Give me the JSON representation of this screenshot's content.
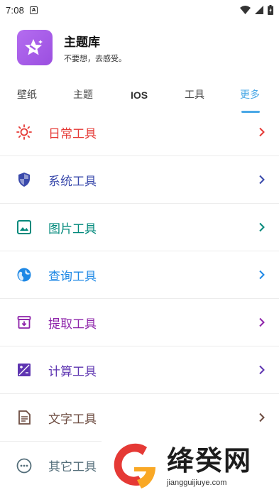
{
  "status_bar": {
    "time": "7:08"
  },
  "app": {
    "title": "主题库",
    "subtitle": "不要想，去感受。"
  },
  "tabs": [
    {
      "label": "壁纸"
    },
    {
      "label": "主题"
    },
    {
      "label": "IOS"
    },
    {
      "label": "工具"
    },
    {
      "label": "更多",
      "active": true
    }
  ],
  "items": [
    {
      "label": "日常工具",
      "icon": "sun-icon",
      "color": "#e53935"
    },
    {
      "label": "系统工具",
      "icon": "shield-icon",
      "color": "#3949ab"
    },
    {
      "label": "图片工具",
      "icon": "image-icon",
      "color": "#00897b"
    },
    {
      "label": "查询工具",
      "icon": "globe-icon",
      "color": "#1e88e5"
    },
    {
      "label": "提取工具",
      "icon": "archive-icon",
      "color": "#8e24aa"
    },
    {
      "label": "计算工具",
      "icon": "calculator-icon",
      "color": "#5e35b1"
    },
    {
      "label": "文字工具",
      "icon": "document-icon",
      "color": "#6d4c41"
    },
    {
      "label": "其它工具",
      "icon": "more-icon",
      "color": "#546e7a"
    }
  ],
  "watermark": {
    "title": "绛癸网",
    "url": "jiangguijiuye.com"
  }
}
